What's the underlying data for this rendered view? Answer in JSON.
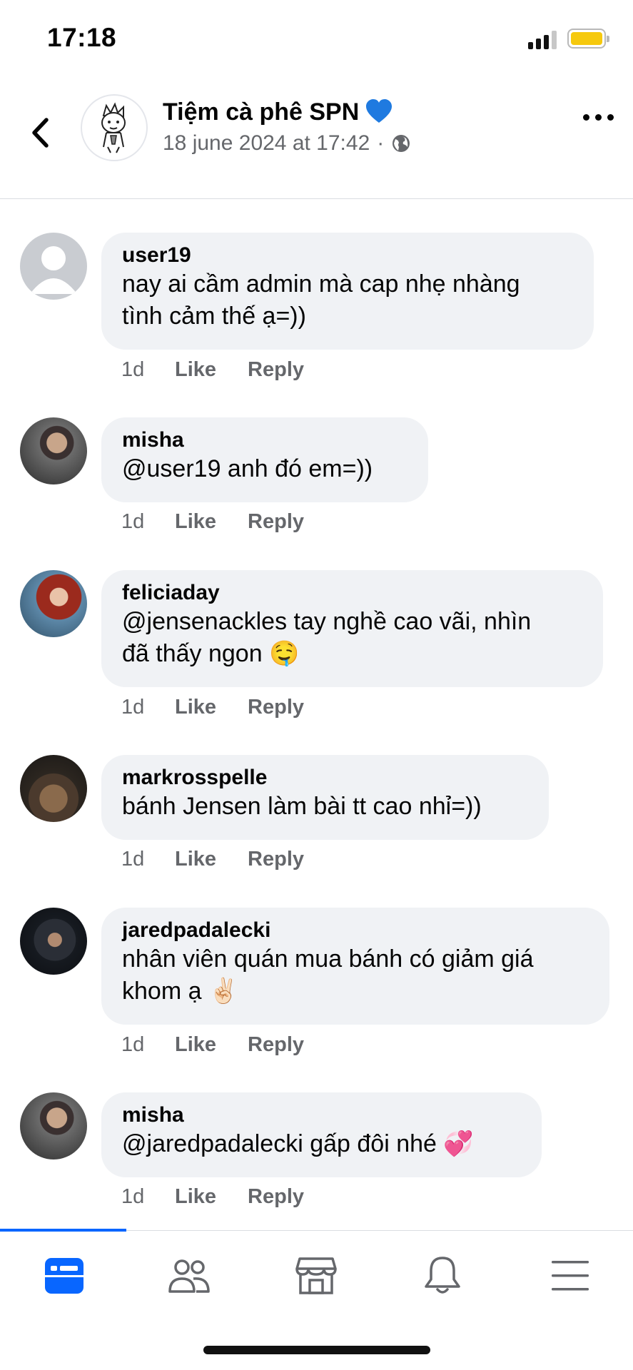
{
  "status_bar": {
    "time": "17:18",
    "signal_icon": "cellular-signal-icon",
    "battery_icon": "battery-icon",
    "battery_color": "#f6c90e"
  },
  "header": {
    "back_icon": "chevron-left-icon",
    "page_name": "Tiệm cà phê SPN",
    "page_name_emoji": "blue-heart-icon",
    "date": "18 june 2024 at 17:42",
    "separator": "·",
    "privacy_icon": "globe-icon",
    "more_icon": "more-horizontal-icon"
  },
  "comments": [
    {
      "name": "user19",
      "text": "nay ai cầm admin mà cap nhẹ nhàng\ntình cảm thế ạ=))",
      "time": "1d",
      "like": "Like",
      "reply": "Reply"
    },
    {
      "name": "misha",
      "text": "@user19 anh đó em=))",
      "time": "1d",
      "like": "Like",
      "reply": "Reply"
    },
    {
      "name": "feliciaday",
      "text": "@jensenackles tay nghề cao vãi, nhìn\nđã thấy ngon 🤤",
      "time": "1d",
      "like": "Like",
      "reply": "Reply"
    },
    {
      "name": "markrosspelle",
      "text": "bánh Jensen làm bài tt cao nhỉ=))",
      "time": "1d",
      "like": "Like",
      "reply": "Reply"
    },
    {
      "name": "jaredpadalecki",
      "text": "nhân viên quán mua bánh có giảm giá\nkhom ạ ✌🏻",
      "time": "1d",
      "like": "Like",
      "reply": "Reply"
    },
    {
      "name": "misha",
      "text": "@jaredpadalecki gấp đôi nhé 💞",
      "time": "1d",
      "like": "Like",
      "reply": "Reply"
    }
  ],
  "bottom_nav": {
    "accent_color": "#0866ff",
    "tabs": [
      {
        "icon": "feed-icon",
        "active": true
      },
      {
        "icon": "friends-icon",
        "active": false
      },
      {
        "icon": "marketplace-icon",
        "active": false
      },
      {
        "icon": "bell-icon",
        "active": false
      },
      {
        "icon": "menu-icon",
        "active": false
      }
    ]
  }
}
